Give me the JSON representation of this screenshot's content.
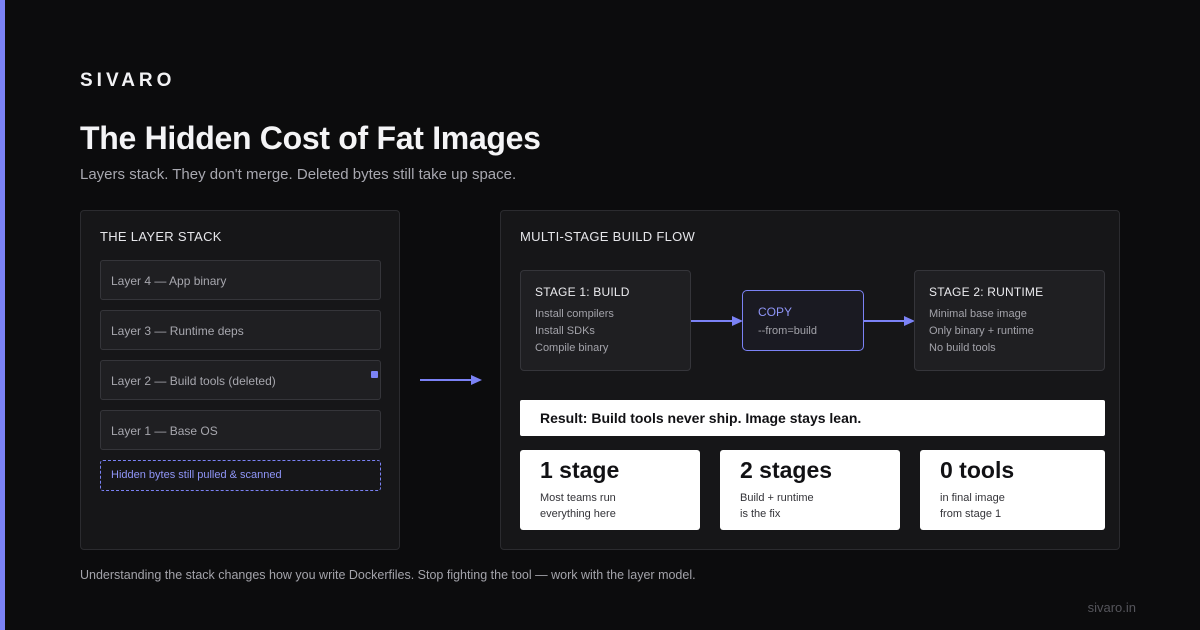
{
  "brand": "SIVARO",
  "title": "The Hidden Cost of Fat Images",
  "subtitle": "Layers stack. They don't merge. Deleted bytes still take up space.",
  "accent_color": "#7b82f5",
  "layer_stack": {
    "title": "THE LAYER STACK",
    "layers": [
      "Layer 4 — App binary",
      "Layer 3 — Runtime deps",
      "Layer 2 — Build tools (deleted)",
      "Layer 1 — Base OS"
    ],
    "note": "Hidden bytes still pulled & scanned"
  },
  "build_flow": {
    "title": "MULTI-STAGE BUILD FLOW",
    "stage1": {
      "title": "STAGE 1: BUILD",
      "lines": [
        "Install compilers",
        "Install SDKs",
        "Compile binary"
      ]
    },
    "copy": {
      "label": "COPY",
      "sub": "--from=build"
    },
    "stage2": {
      "title": "STAGE 2: RUNTIME",
      "lines": [
        "Minimal base image",
        "Only binary + runtime",
        "No build tools"
      ]
    },
    "result": "Result: Build tools never ship. Image stays lean.",
    "stats": [
      {
        "big": "1 stage",
        "line1": "Most teams run",
        "line2": "everything here"
      },
      {
        "big": "2 stages",
        "line1": "Build + runtime",
        "line2": "is the fix"
      },
      {
        "big": "0 tools",
        "line1": "in final image",
        "line2": "from stage 1"
      }
    ]
  },
  "footer": "Understanding the stack changes how you write Dockerfiles. Stop fighting the tool — work with the layer model.",
  "url": "sivaro.in"
}
